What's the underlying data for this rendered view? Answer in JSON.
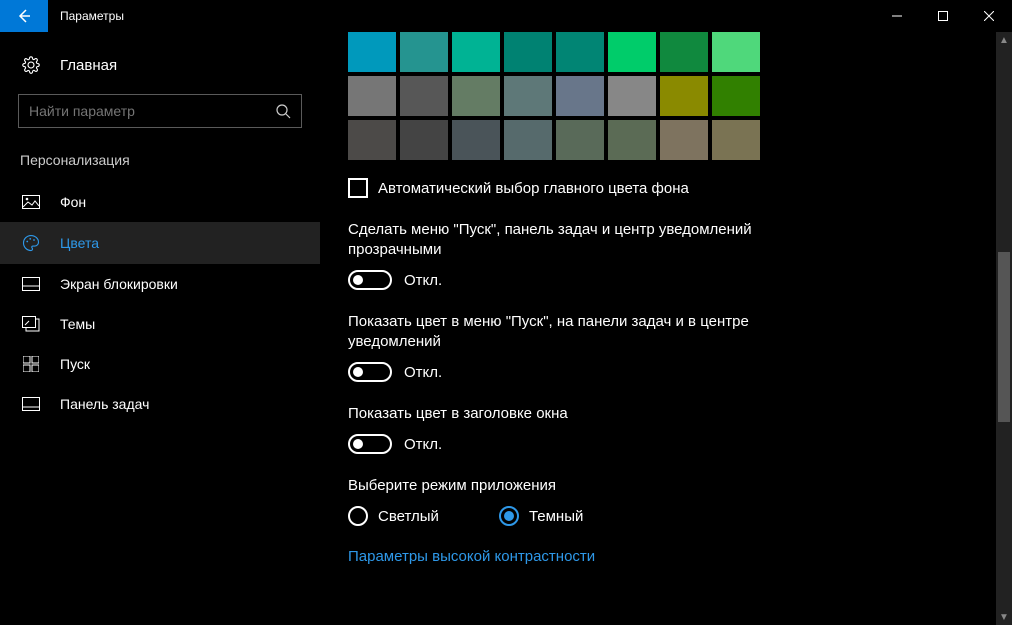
{
  "window": {
    "title": "Параметры"
  },
  "sidebar": {
    "home": "Главная",
    "search_placeholder": "Найти параметр",
    "section": "Персонализация",
    "items": [
      {
        "label": "Фон"
      },
      {
        "label": "Цвета"
      },
      {
        "label": "Экран блокировки"
      },
      {
        "label": "Темы"
      },
      {
        "label": "Пуск"
      },
      {
        "label": "Панель задач"
      }
    ]
  },
  "colors": {
    "rows": [
      [
        "#0099bc",
        "#259490",
        "#00b394",
        "#008272",
        "#018574",
        "#00cc6a",
        "#10893e",
        "#4fd87b"
      ],
      [
        "#767676",
        "#575757",
        "#647c64",
        "#5e7878",
        "#68768a",
        "#878787",
        "#8a8a00",
        "#318000"
      ],
      [
        "#4c4a48",
        "#444444",
        "#4a5459",
        "#566a6c",
        "#596a59",
        "#5b6b55",
        "#7e735f",
        "#7a7353"
      ]
    ]
  },
  "checkbox": {
    "label": "Автоматический выбор главного цвета фона"
  },
  "toggles": [
    {
      "label": "Сделать меню \"Пуск\", панель задач и центр уведомлений прозрачными",
      "state": "Откл."
    },
    {
      "label": "Показать цвет в меню \"Пуск\", на панели задач и в центре уведомлений",
      "state": "Откл."
    },
    {
      "label": "Показать цвет в заголовке окна",
      "state": "Откл."
    }
  ],
  "mode": {
    "label": "Выберите режим приложения",
    "options": [
      {
        "label": "Светлый",
        "selected": false
      },
      {
        "label": "Темный",
        "selected": true
      }
    ]
  },
  "link": "Параметры высокой контрастности"
}
